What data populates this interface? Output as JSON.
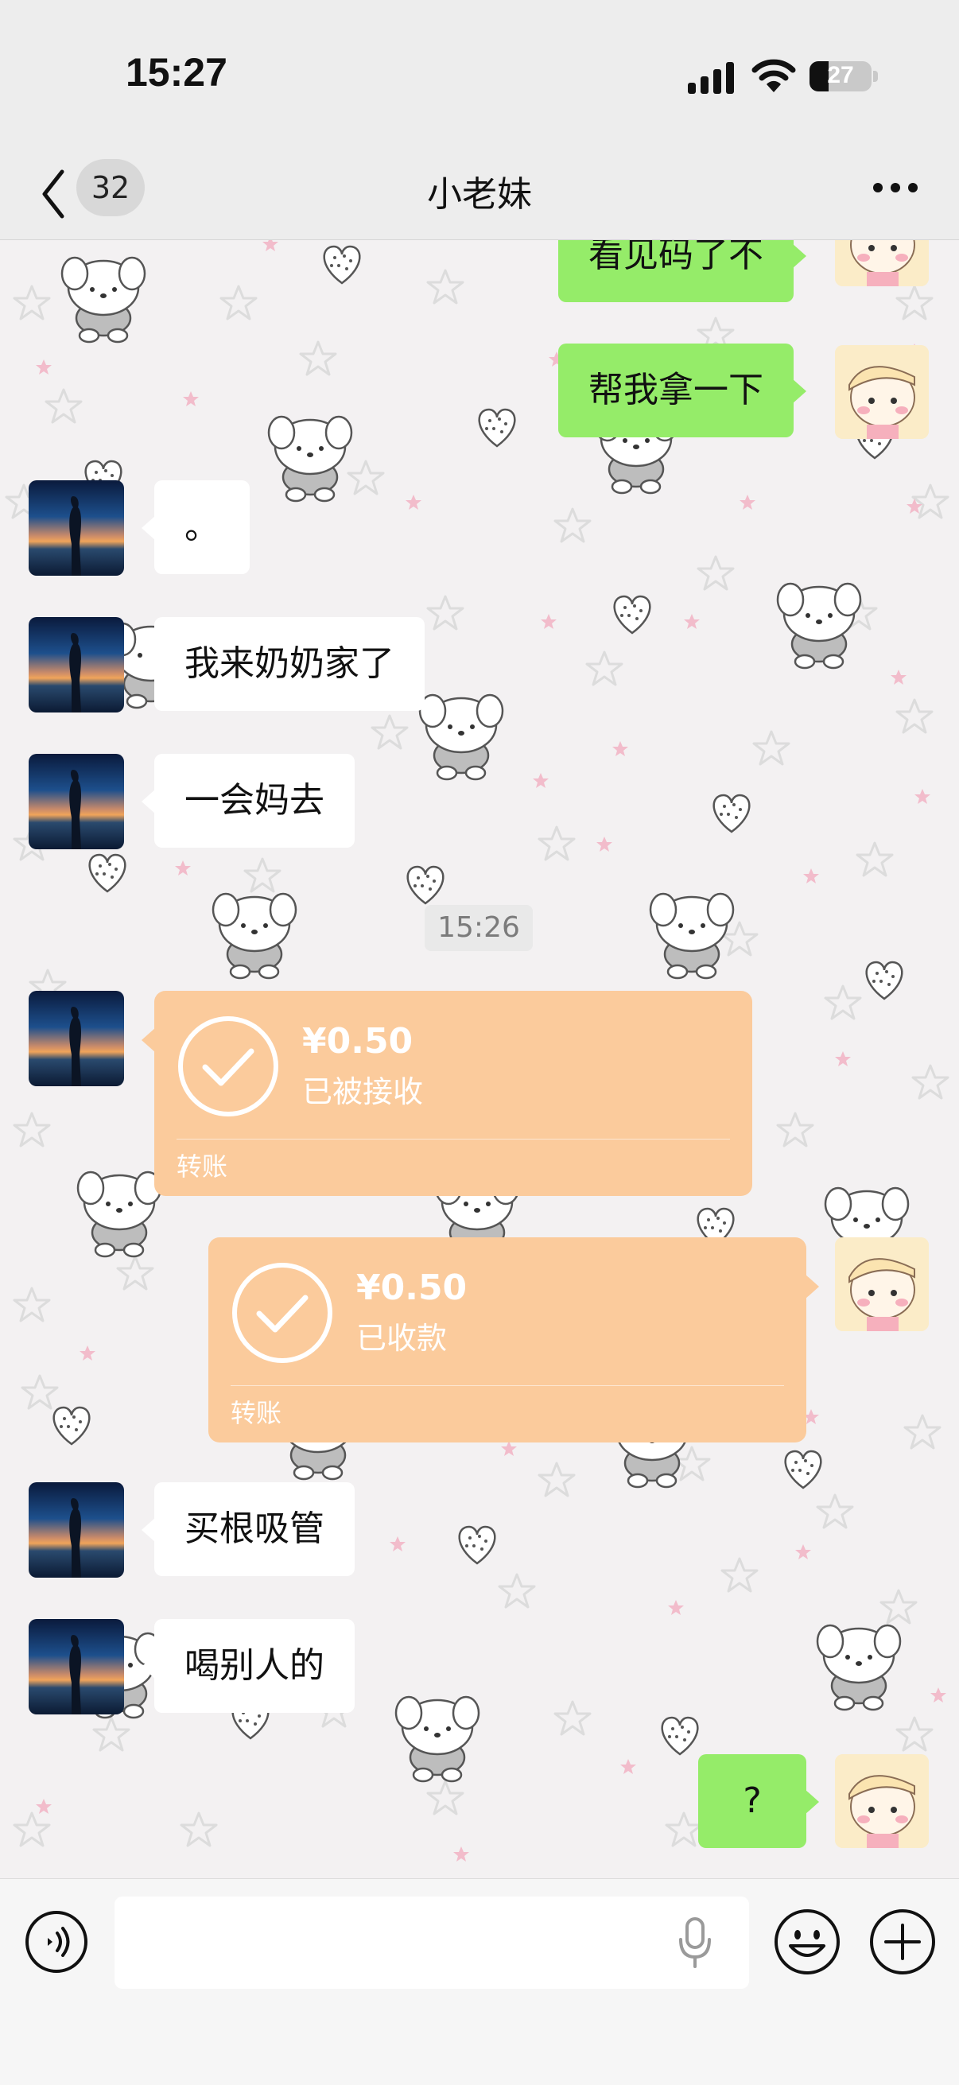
{
  "status_bar": {
    "time": "15:27",
    "battery_level": "27",
    "icons": [
      "signal-icon",
      "wifi-icon",
      "battery-icon"
    ]
  },
  "header": {
    "back_icon": "chevron-left-icon",
    "unread_count": "32",
    "title": "小老妹",
    "more_icon": "ellipsis-icon"
  },
  "messages": [
    {
      "side": "out",
      "type": "text",
      "text": "看见码了不"
    },
    {
      "side": "out",
      "type": "text",
      "text": "帮我拿一下"
    },
    {
      "side": "in",
      "type": "text",
      "text": "。"
    },
    {
      "side": "in",
      "type": "text",
      "text": "我来奶奶家了"
    },
    {
      "side": "in",
      "type": "text",
      "text": "一会妈去"
    },
    {
      "type": "timestamp",
      "text": "15:26"
    },
    {
      "side": "in",
      "type": "transfer",
      "amount": "¥0.50",
      "status": "已被接收",
      "label": "转账"
    },
    {
      "side": "out",
      "type": "transfer",
      "amount": "¥0.50",
      "status": "已收款",
      "label": "转账"
    },
    {
      "side": "in",
      "type": "text",
      "text": "买根吸管"
    },
    {
      "side": "in",
      "type": "text",
      "text": "喝别人的"
    },
    {
      "side": "out",
      "type": "text",
      "text": "?"
    }
  ],
  "colors": {
    "outgoing_bubble": "#95ec69",
    "incoming_bubble": "#ffffff",
    "transfer_card": "#fbcb9c",
    "background": "#ededed"
  },
  "input_bar": {
    "voice_icon": "voice-icon",
    "input_value": "",
    "mic_icon": "microphone-icon",
    "emoji_icon": "emoji-icon",
    "plus_icon": "plus-icon"
  }
}
